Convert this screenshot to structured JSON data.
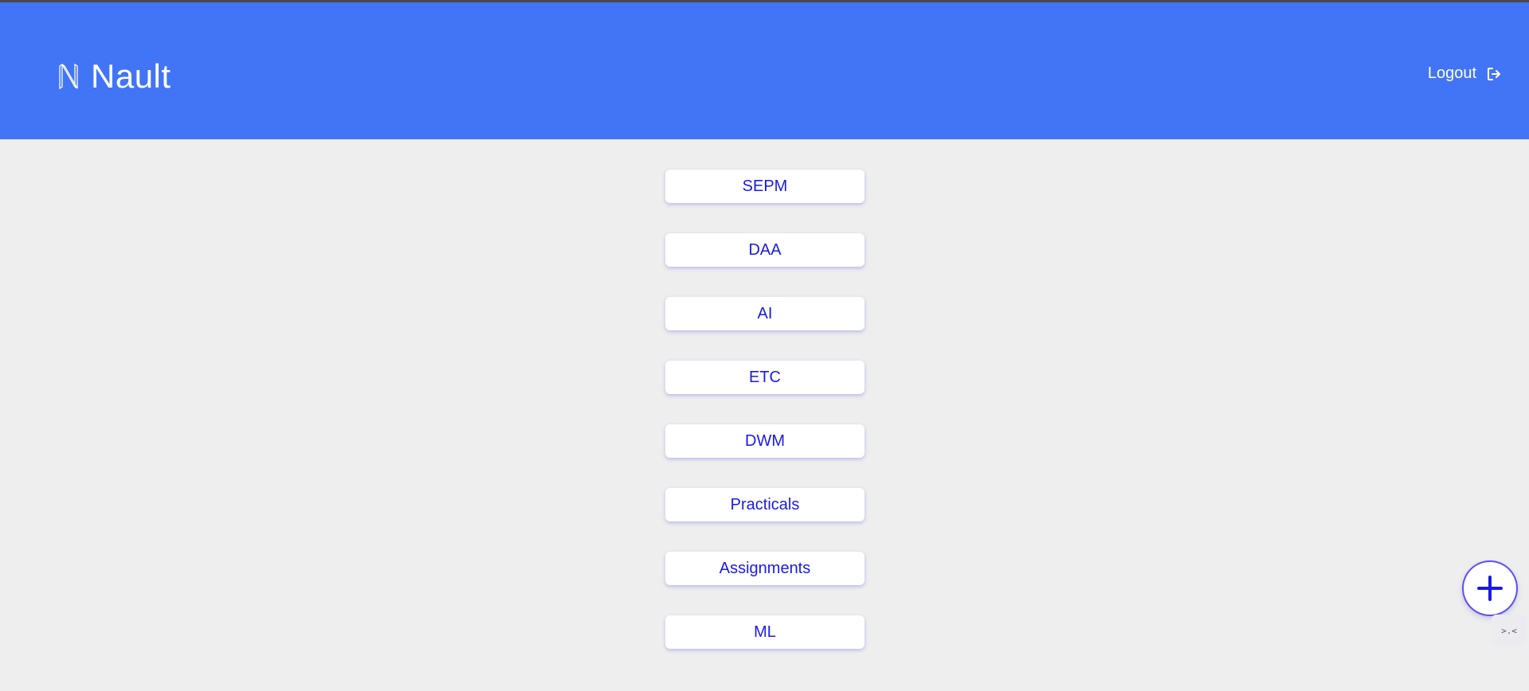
{
  "header": {
    "brand_name": "Nault",
    "logout_label": "Logout",
    "background_color": "#4274f6"
  },
  "subjects": [
    {
      "label": "SEPM"
    },
    {
      "label": "DAA"
    },
    {
      "label": "AI"
    },
    {
      "label": "ETC"
    },
    {
      "label": "DWM"
    },
    {
      "label": "Practicals"
    },
    {
      "label": "Assignments"
    },
    {
      "label": "ML"
    }
  ],
  "fab": {
    "icon": "plus-icon",
    "accent_color": "#1a1ae6"
  },
  "mini_widget": {
    "glyph": ">.<"
  }
}
